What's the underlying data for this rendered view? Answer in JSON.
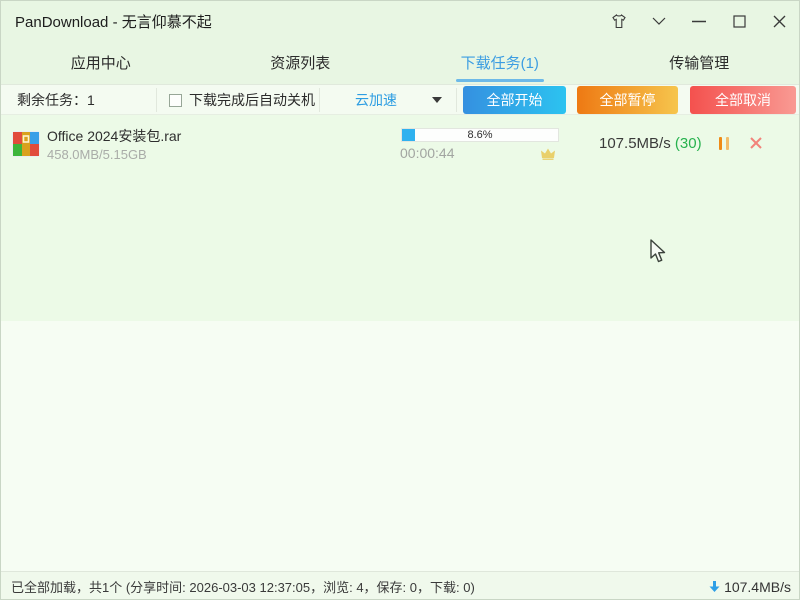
{
  "window": {
    "title": "PanDownload - 无言仰慕不起"
  },
  "titlebar_icons": [
    "skin-shirt-icon",
    "chevron-down-icon",
    "minimize-icon",
    "maximize-icon",
    "close-icon"
  ],
  "tabs": [
    {
      "label": "应用中心",
      "active": false
    },
    {
      "label": "资源列表",
      "active": false
    },
    {
      "label": "下载任务(1)",
      "active": true
    },
    {
      "label": "传输管理",
      "active": false
    }
  ],
  "toolbar": {
    "remaining_label": "剩余任务：1",
    "shutdown_label": "下载完成后自动关机",
    "shutdown_checked": false,
    "accelerate_label": "云加速",
    "start_all": "全部开始",
    "pause_all": "全部暂停",
    "cancel_all": "全部取消"
  },
  "task": {
    "filename": "Office 2024安装包.rar",
    "size": "458.0MB/5.15GB",
    "progress_percent": "8.6%",
    "progress_value": 8.6,
    "elapsed": "00:00:44",
    "speed": "107.5MB/s",
    "threads": "(30)"
  },
  "statusbar": {
    "summary": "已全部加载，共1个 (分享时间: 2026-03-03 12:37:05，浏览: 4，保存: 0，下载: 0)",
    "total_speed": "107.4MB/s"
  },
  "colors": {
    "active_tab": "#3c9de2",
    "tab_underline": "#6db9e8",
    "btn_start_gradient": [
      "#3590e0",
      "#2cc3f0"
    ],
    "btn_pause_gradient": [
      "#ee7913",
      "#f6c54d"
    ],
    "btn_cancel_gradient": [
      "#f4514e",
      "#f99a93"
    ],
    "progress_fill": "#2fb1ef",
    "threads_green": "#27b24e",
    "accel_blue": "#2d9de2",
    "titlebar_bg": "#e8f6e3",
    "content_upper_bg": "#ecfae7",
    "content_lower_bg": "#f6fdf3"
  }
}
